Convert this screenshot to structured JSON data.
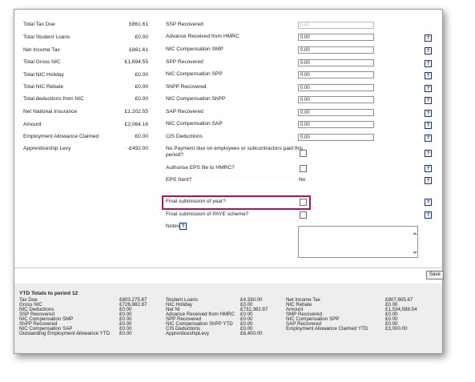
{
  "left_summary": [
    {
      "label": "Total Tax Due",
      "value": "£861.61"
    },
    {
      "label": "Total Student Loans",
      "value": "£0.00"
    },
    {
      "label": "Net Income Tax",
      "value": "£861.61"
    },
    {
      "label": "Total Gross NIC",
      "value": "£1,694.55"
    },
    {
      "label": "Total NIC Holiday",
      "value": "£0.00"
    },
    {
      "label": "Total NIC Rebate",
      "value": "£0.00"
    },
    {
      "label": "Total deductions from NIC",
      "value": "£0.00"
    },
    {
      "label": "Net National Insurance",
      "value": "£1,202.55"
    },
    {
      "label": "Amount",
      "value": "£2,064.16"
    },
    {
      "label": "Employment Allowance Claimed",
      "value": "£0.00"
    },
    {
      "label": "Apprenticeship Levy",
      "value": "-£492.00"
    }
  ],
  "recovery_fields": [
    {
      "label": "SSP Recovered",
      "value": "0.00",
      "disabled": true,
      "help": false
    },
    {
      "label": "Advance Received from HMRC",
      "value": "0.00",
      "help": true
    },
    {
      "label": "NIC Compensation SMP",
      "value": "0.00",
      "help": true
    },
    {
      "label": "SPP Recovered",
      "value": "0.00",
      "help": true
    },
    {
      "label": "NIC Compensation SPP",
      "value": "0.00",
      "help": true
    },
    {
      "label": "ShPP Recovered",
      "value": "0.00",
      "help": true
    },
    {
      "label": "NIC Compensation ShPP",
      "value": "0.00",
      "help": true
    },
    {
      "label": "SAP Recovered",
      "value": "0.00",
      "help": true
    },
    {
      "label": "NIC Compensation SAP",
      "value": "0.00",
      "help": true
    },
    {
      "label": "CIS Deductions",
      "value": "0.00",
      "help": true
    }
  ],
  "options": {
    "no_payment_label_line1": "No Payment due on employees or subcontractors paid this",
    "no_payment_label_line2": "period?",
    "authorise_label": "Authorise EPS file to HMRC?",
    "eps_sent_label": "EPS Sent?",
    "eps_sent_value": "No",
    "final_year_label": "Final submission of year?",
    "final_paye_label": "Final submission of PAYE scheme?",
    "notes_label": "Notes",
    "help_glyph": "?"
  },
  "save_label": "Save",
  "ytd": {
    "title": "YTD Totals to period 12",
    "col1": [
      {
        "label": "Tax Due",
        "value": "£803,275.67"
      },
      {
        "label": "Gross NIC",
        "value": "£726,982.87"
      },
      {
        "label": "NIC Deductions",
        "value": "£0.00"
      },
      {
        "label": "SSP Recovered",
        "value": "£0.00"
      },
      {
        "label": "NIC Compensation SMP",
        "value": "£0.00"
      },
      {
        "label": "ShPP Recovered",
        "value": "£0.00"
      },
      {
        "label": "NIC Compensation SAP",
        "value": "£0.00"
      },
      {
        "label": "Outstanding Employment Allowance YTD",
        "value": "£0.00"
      }
    ],
    "col2": [
      {
        "label": "Student Loans",
        "value": "£4,330.00"
      },
      {
        "label": "NIC Holiday",
        "value": "£0.00"
      },
      {
        "label": "Net NI",
        "value": "£732,382.87"
      },
      {
        "label": "Advance Received from HMRC",
        "value": "£0.00"
      },
      {
        "label": "SPP Recovered",
        "value": "£0.00"
      },
      {
        "label": "NIC Compensation ShPP YTD",
        "value": "£0.00"
      },
      {
        "label": "CIS Deductions",
        "value": "£0.00"
      },
      {
        "label": "ApprenticeshipLevy",
        "value": "£8,400.00"
      }
    ],
    "col3": [
      {
        "label": "Net Income Tax",
        "value": "£807,605.67"
      },
      {
        "label": "NIC Rebate",
        "value": "£0.00"
      },
      {
        "label": "Amount",
        "value": "£1,534,588.54"
      },
      {
        "label": "SMP Recovered",
        "value": "£0.00"
      },
      {
        "label": "NIC Compensation SPP",
        "value": "£0.00"
      },
      {
        "label": "SAP Recovered",
        "value": "£0.00"
      },
      {
        "label": "Employment Allowance Claimed YTD",
        "value": "£3,000.00"
      }
    ]
  }
}
